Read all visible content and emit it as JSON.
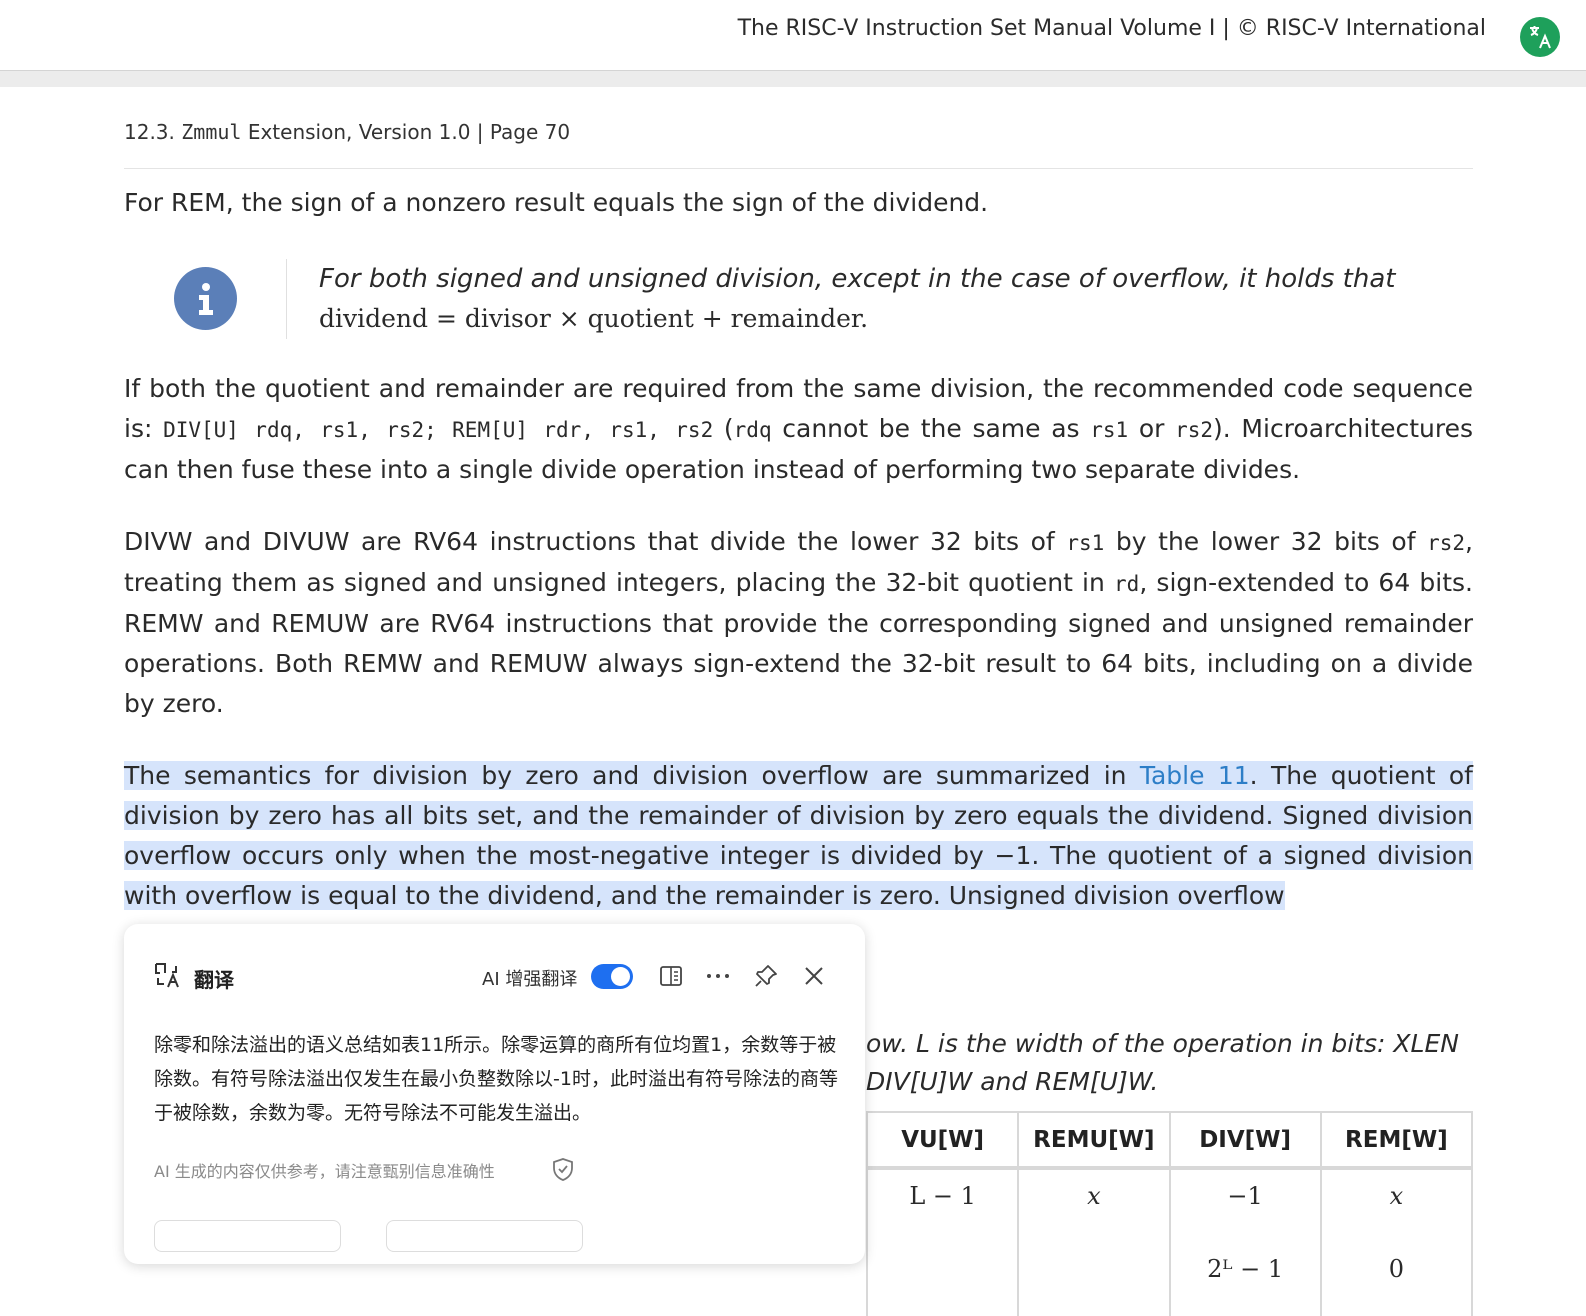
{
  "header": {
    "title": "The RISC-V Instruction Set Manual Volume I | © RISC-V International"
  },
  "page": {
    "hdr_section": "12.3. ",
    "hdr_code": "Zmmul",
    "hdr_rest": " Extension, Version 1.0 | Page 70"
  },
  "p1": "For REM, the sign of a nonzero result equals the sign of the dividend.",
  "note": {
    "line1": "For both signed and unsigned division, except in the case of overflow, it holds that",
    "formula": "dividend = divisor × quotient + remainder."
  },
  "p2": {
    "t1": "If both the quotient and remainder are required from the same division, the recommended code sequence is: ",
    "c1": "DIV[U] rdq, rs1, rs2; REM[U] rdr, rs1, rs2",
    "t2": " (",
    "c2": "rdq",
    "t3": " cannot be the same as ",
    "c3": "rs1",
    "t4": " or ",
    "c4": "rs2",
    "t5": "). Microarchitectures can then fuse these into a single divide operation instead of performing two separate divides."
  },
  "p3": {
    "t1": "DIVW and DIVUW are RV64 instructions that divide the lower 32 bits of ",
    "c1": "rs1",
    "t2": " by the lower 32 bits of ",
    "c2": "rs2",
    "t3": ", treating them as signed and unsigned integers, placing the 32-bit quotient in ",
    "c3": "rd",
    "t4": ", sign-extended to 64 bits. REMW and REMUW are RV64 instructions that provide the corresponding signed and unsigned remainder operations. Both REMW and REMUW always sign-extend the 32-bit result to 64 bits, including on a divide by zero."
  },
  "p4": {
    "t1": "The semantics for division by zero and division overflow are summarized in ",
    "link": "Table 11",
    "t2": ". The quotient of division by zero has all bits set, and the remainder of division by zero equals the dividend. Signed division overflow occurs only when the most-negative integer is divided by −1. The quotient of a signed division with overflow is equal to the dividend, and the remainder is zero. Unsigned division overflow"
  },
  "caption": {
    "line1": "ow. L is the width of the operation in bits: XLEN",
    "line2": "DIV[U]W and REM[U]W."
  },
  "table": {
    "headers": [
      "VU[W]",
      "REMU[W]",
      "DIV[W]",
      "REM[W]"
    ],
    "row1": [
      "L − 1",
      "x",
      "−1",
      "x"
    ],
    "row2": [
      "",
      "",
      "2ᴸ − 1",
      "0"
    ]
  },
  "popup": {
    "title": "翻译",
    "ai_label": "AI 增强翻译",
    "ai_enabled": true,
    "text": "除零和除法溢出的语义总结如表11所示。除零运算的商所有位均置1，余数等于被除数。有符号除法溢出仅发生在最小负整数除以-1时，此时溢出有符号除法的商等于被除数，余数为零。无符号除法不可能发生溢出。",
    "disclaimer": "AI 生成的内容仅供参考，请注意甄别信息准确性"
  },
  "colors": {
    "highlight": "#d6e4fb",
    "link": "#2d7ec7",
    "toggle": "#1e6ff0",
    "note_icon": "#5b7fb8",
    "translate_button": "#1ea05b"
  },
  "icons": [
    "translate-icon",
    "info-icon",
    "split-view-icon",
    "more-icon",
    "pin-icon",
    "close-icon",
    "shield-icon"
  ]
}
